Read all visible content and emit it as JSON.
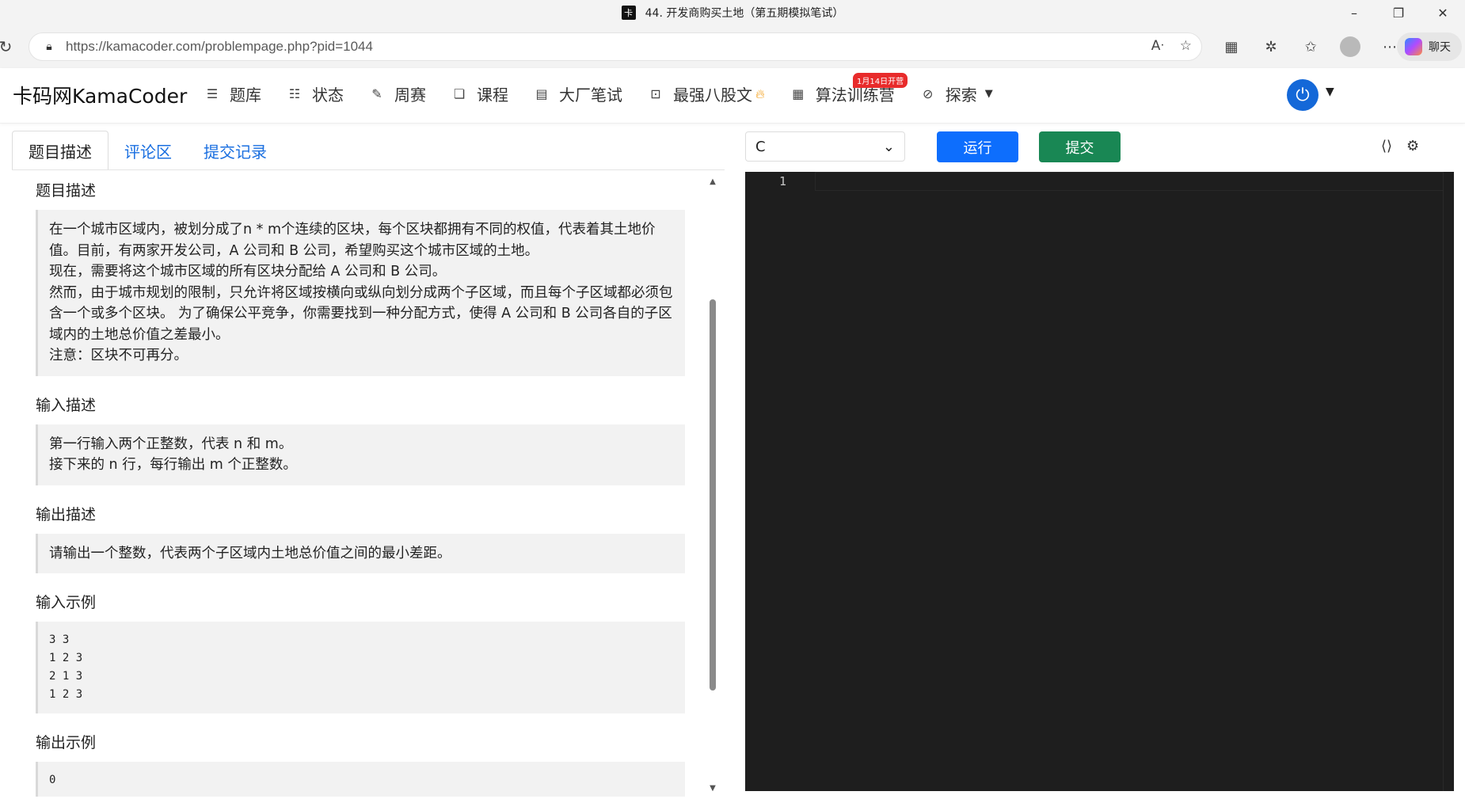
{
  "browser": {
    "window_title": "44. 开发商购买土地（第五期模拟笔试）",
    "favicon_glyph": "卡",
    "controls": {
      "minimize": "–",
      "maximize": "❐",
      "close": "✕"
    },
    "url": "https://kamacoder.com/problempage.php?pid=1044",
    "copilot_label": "聊天"
  },
  "site": {
    "brand": "卡码网KamaCoder",
    "nav": [
      {
        "label": "题库",
        "icon": "list-icon",
        "glyph": "☰"
      },
      {
        "label": "状态",
        "icon": "status-list-icon",
        "glyph": "☷"
      },
      {
        "label": "周赛",
        "icon": "pencil-icon",
        "glyph": "✎"
      },
      {
        "label": "课程",
        "icon": "copy-icon",
        "glyph": "❏"
      },
      {
        "label": "大厂笔试",
        "icon": "notes-icon",
        "glyph": "▤"
      },
      {
        "label": "最强八股文",
        "icon": "code-file-icon",
        "glyph": "⊡"
      },
      {
        "label": "算法训练营",
        "icon": "calendar-icon",
        "glyph": "▦"
      },
      {
        "label": "探索",
        "icon": "compass-icon",
        "glyph": "⊘"
      }
    ],
    "badge": "1月14日开营",
    "accent": "#0d6efd"
  },
  "left": {
    "tabs": [
      "题目描述",
      "评论区",
      "提交记录"
    ],
    "sections": {
      "desc_title": "题目描述",
      "desc_lines": [
        "在一个城市区域内，被划分成了n * m个连续的区块，每个区块都拥有不同的权值，代表着其土地价值。目前，有两家开发公司，A 公司和 B 公司，希望购买这个城市区域的土地。",
        "现在，需要将这个城市区域的所有区块分配给 A 公司和 B 公司。",
        "然而，由于城市规划的限制，只允许将区域按横向或纵向划分成两个子区域，而且每个子区域都必须包含一个或多个区块。 为了确保公平竞争，你需要找到一种分配方式，使得 A 公司和 B 公司各自的子区域内的土地总价值之差最小。",
        "注意：区块不可再分。"
      ],
      "input_title": "输入描述",
      "input_lines": [
        "第一行输入两个正整数，代表 n 和 m。",
        "接下来的 n 行，每行输出 m 个正整数。"
      ],
      "output_title": "输出描述",
      "output_line": "请输出一个整数，代表两个子区域内土地总价值之间的最小差距。",
      "sample_in_title": "输入示例",
      "sample_in": "3 3\n1 2 3\n2 1 3\n1 2 3",
      "sample_out_title": "输出示例",
      "sample_out": "0"
    }
  },
  "right": {
    "language": "C",
    "run_label": "运行",
    "submit_label": "提交",
    "run_color": "#0d6efd",
    "submit_color": "#198754",
    "editor_line_number": "1"
  }
}
